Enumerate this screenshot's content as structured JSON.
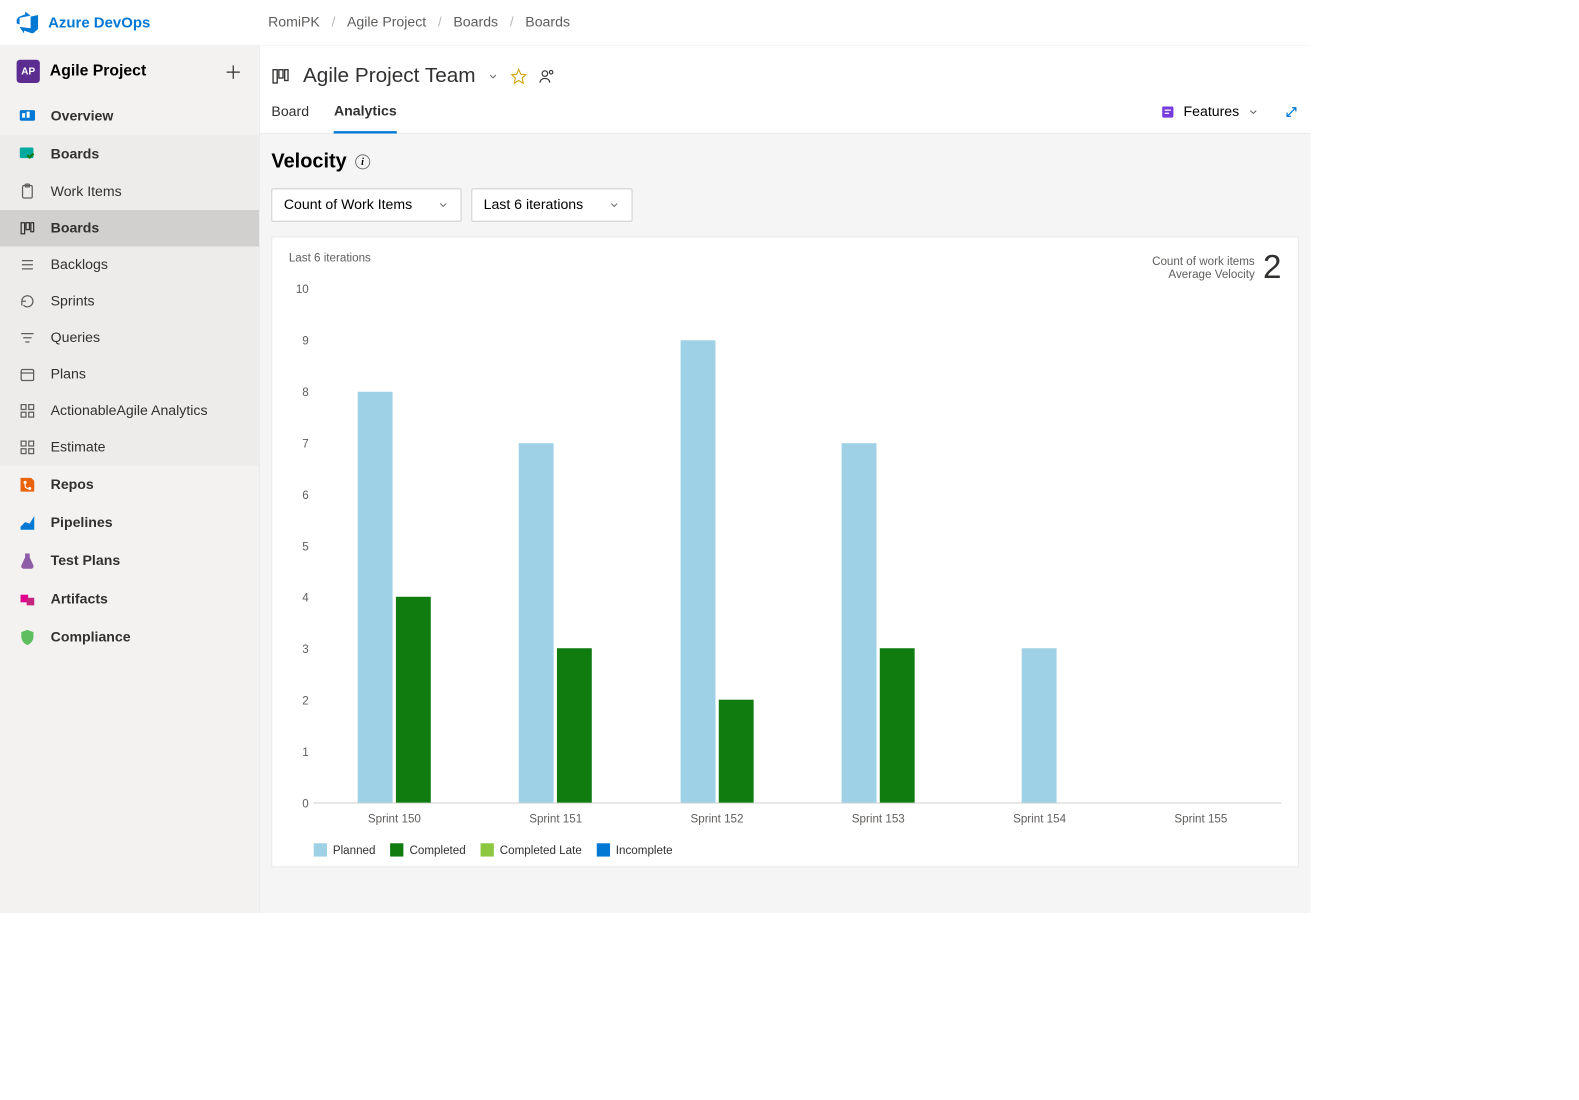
{
  "colors": {
    "accent": "#0078d4",
    "planned": "#9ed0e6",
    "completed": "#107c10",
    "completed_late": "#8dc63f",
    "incomplete": "#0078d4"
  },
  "topbar": {
    "product": "Azure DevOps",
    "breadcrumbs": [
      "RomiPK",
      "Agile Project",
      "Boards",
      "Boards"
    ]
  },
  "project": {
    "badge": "AP",
    "name": "Agile Project"
  },
  "sidebar": {
    "overview": "Overview",
    "boards": "Boards",
    "boards_sub": [
      "Work Items",
      "Boards",
      "Backlogs",
      "Sprints",
      "Queries",
      "Plans",
      "ActionableAgile Analytics",
      "Estimate"
    ],
    "repos": "Repos",
    "pipelines": "Pipelines",
    "test_plans": "Test Plans",
    "artifacts": "Artifacts",
    "compliance": "Compliance"
  },
  "team": {
    "name": "Agile Project Team"
  },
  "tabs": {
    "board": "Board",
    "analytics": "Analytics",
    "features": "Features"
  },
  "velocity": {
    "title": "Velocity",
    "dropdown_metric": "Count of Work Items",
    "dropdown_range": "Last 6 iterations"
  },
  "chart_header": {
    "subtitle": "Last 6 iterations",
    "kpi_line1": "Count of work items",
    "kpi_line2": "Average Velocity",
    "kpi_value": "2"
  },
  "legend": {
    "planned": "Planned",
    "completed": "Completed",
    "completed_late": "Completed Late",
    "incomplete": "Incomplete"
  },
  "chart_data": {
    "type": "bar",
    "title": "Velocity",
    "xlabel": "",
    "ylabel": "",
    "ylim": [
      0,
      10
    ],
    "yticks": [
      0,
      1,
      2,
      3,
      4,
      5,
      6,
      7,
      8,
      9,
      10
    ],
    "categories": [
      "Sprint 150",
      "Sprint 151",
      "Sprint 152",
      "Sprint 153",
      "Sprint 154",
      "Sprint 155"
    ],
    "series": [
      {
        "name": "Planned",
        "values": [
          8,
          7,
          9,
          7,
          3,
          0
        ]
      },
      {
        "name": "Completed",
        "values": [
          4,
          3,
          2,
          3,
          0,
          0
        ]
      },
      {
        "name": "Completed Late",
        "values": [
          0,
          0,
          0,
          0,
          0,
          0
        ]
      },
      {
        "name": "Incomplete",
        "values": [
          0,
          0,
          0,
          0,
          0,
          0
        ]
      }
    ]
  }
}
